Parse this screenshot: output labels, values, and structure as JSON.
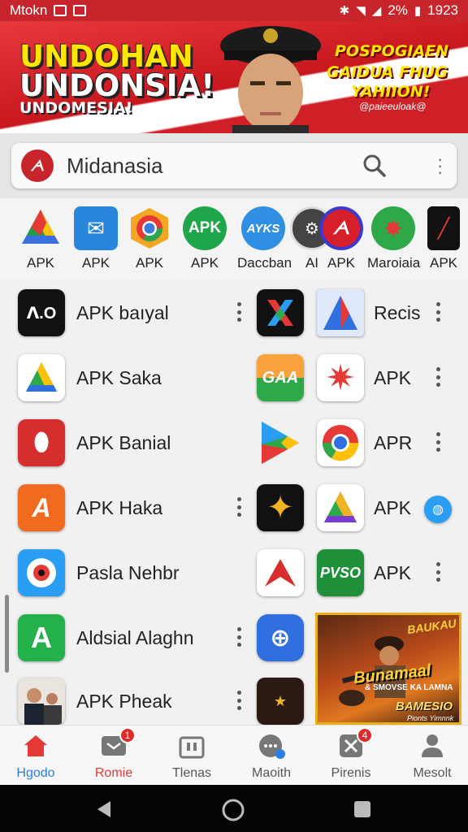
{
  "status": {
    "carrier": "Mtokn",
    "battery": "2%",
    "time": "1923"
  },
  "banner": {
    "line1": "UNDOHAN",
    "line2": "UNDONSIA!",
    "line3": "UNDOMESIA!",
    "right1": "POSPOGIAEN",
    "right2": "GAIDUA FHUG",
    "right3": "YAHIION!",
    "right4": "@paieeuloak@"
  },
  "search": {
    "value": "Midanasia"
  },
  "top_apps": [
    {
      "label": "APK",
      "icon": "drive-icon"
    },
    {
      "label": "APK",
      "icon": "mail-icon"
    },
    {
      "label": "APK",
      "icon": "chrome-icon"
    },
    {
      "label": "APK",
      "icon": "apk-icon",
      "text": "APK"
    },
    {
      "label": "Daccban",
      "icon": "daccban-icon",
      "text": "AYKS"
    },
    {
      "label": "AI",
      "icon": "ai-icon"
    },
    {
      "label": "APK",
      "icon": "brand-icon"
    },
    {
      "label": "Maroiaia",
      "icon": "star-burst-icon"
    },
    {
      "label": "APK",
      "icon": "phone-icon"
    }
  ],
  "apps": [
    {
      "name": "APK baıyal",
      "icon": "apk-bayal-icon"
    },
    {
      "name": "Recis",
      "icon": "recis-icon"
    },
    {
      "name": "APK Saka",
      "icon": "apk-saka-icon"
    },
    {
      "name": "APK",
      "icon": "compass-star-icon"
    },
    {
      "name": "APK Banial",
      "icon": "apk-banial-icon"
    },
    {
      "name": "APR",
      "icon": "chrome-circle-icon"
    },
    {
      "name": "APK Haka",
      "icon": "apk-haka-icon"
    },
    {
      "name": "APK",
      "icon": "triangle-icon"
    },
    {
      "name": "Pasla Nehbr",
      "icon": "pasla-nehbr-icon"
    },
    {
      "name": "APK",
      "icon": "pvso-icon"
    },
    {
      "name": "Aldsial Alaghn",
      "icon": "aldsial-alaghn-icon"
    },
    {
      "name": "APK Pheak",
      "icon": "apk-pheak-icon"
    }
  ],
  "mid_icons": [
    {
      "icon": "x-logo-icon"
    },
    {
      "icon": "gaa-icon",
      "text": "GAA"
    },
    {
      "icon": "play-icon"
    },
    {
      "icon": "star-badge-icon"
    },
    {
      "icon": "red-arrow-icon"
    },
    {
      "icon": "globe-icon"
    },
    {
      "icon": "game-icon"
    }
  ],
  "promo": {
    "line1": "BAUKAU",
    "line2": "Bunamaal",
    "line3": "& SMOVSE KA LAMNA",
    "line4": "BAMESIO",
    "line5": "Pionts Yimnnk"
  },
  "nav": [
    {
      "label": "Hgodo",
      "icon": "home-icon",
      "active": true
    },
    {
      "label": "Romie",
      "icon": "inbox-icon",
      "badge": "1"
    },
    {
      "label": "Tlenas",
      "icon": "bag-icon"
    },
    {
      "label": "Maoith",
      "icon": "chat-icon"
    },
    {
      "label": "Pirenis",
      "icon": "tools-icon",
      "badge": "4"
    },
    {
      "label": "Mesolt",
      "icon": "profile-icon"
    }
  ],
  "colors": {
    "brand": "#c8242b",
    "badge": "#e02a2a",
    "home_active": "#e53935"
  }
}
